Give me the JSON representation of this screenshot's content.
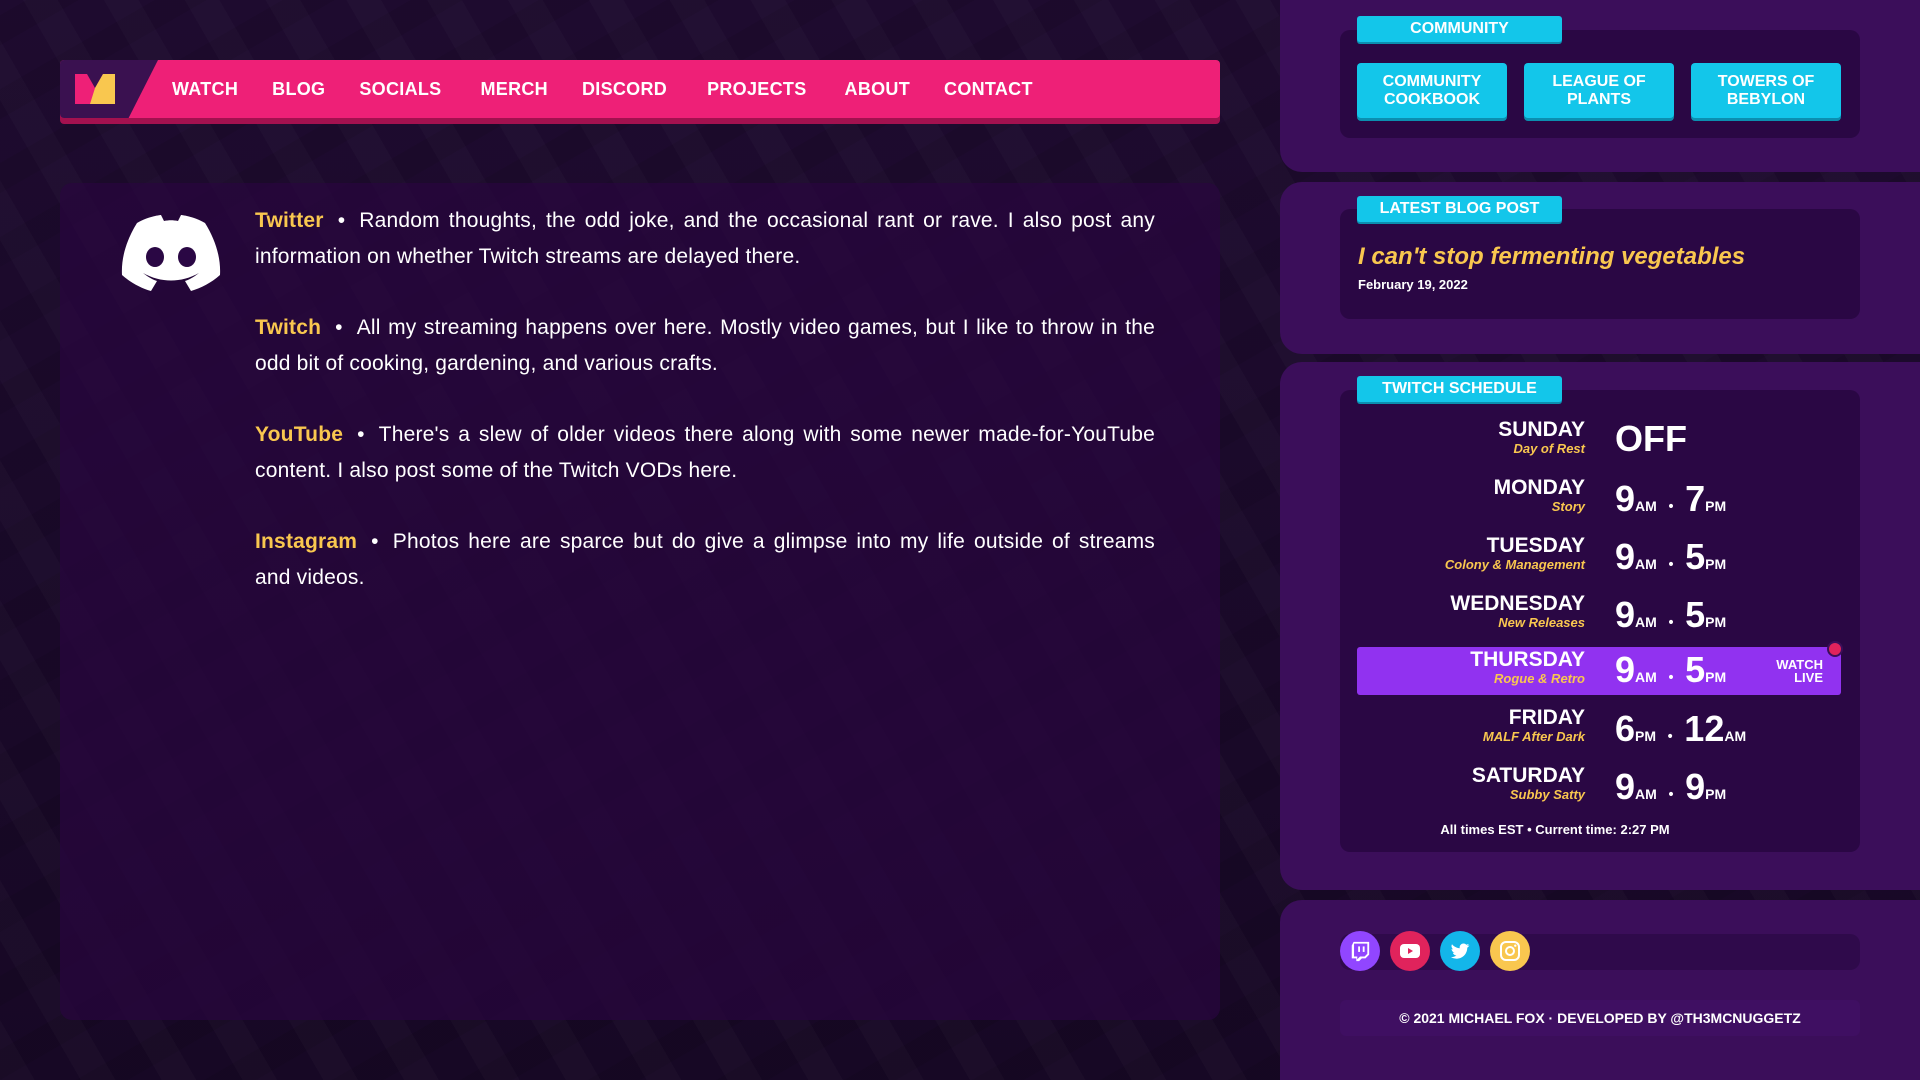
{
  "nav": {
    "items": [
      "WATCH",
      "BLOG",
      "SOCIALS",
      "MERCH",
      "DISCORD",
      "PROJECTS",
      "ABOUT",
      "CONTACT"
    ]
  },
  "socials": [
    {
      "name": "Twitter",
      "text": "Random thoughts, the odd joke, and the occasional rant or rave. I also post any information on whether Twitch streams are delayed there."
    },
    {
      "name": "Twitch",
      "text": "All my streaming happens over here. Mostly video games, but I like to throw in the odd bit of cooking, gardening, and various crafts."
    },
    {
      "name": "YouTube",
      "text": "There's a slew of older videos there along with some newer made-for-YouTube content. I also post some of the Twitch VODs here."
    },
    {
      "name": "Instagram",
      "text": "Photos here are sparce but do give a glimpse into my life outside of streams and videos."
    }
  ],
  "separator": "•",
  "community": {
    "tag": "COMMUNITY",
    "buttons": [
      {
        "line1": "COMMUNITY",
        "line2": "COOKBOOK"
      },
      {
        "line1": "LEAGUE OF",
        "line2": "PLANTS"
      },
      {
        "line1": "TOWERS OF",
        "line2": "BEBYLON"
      }
    ]
  },
  "blog": {
    "tag": "LATEST BLOG POST",
    "title": "I can't stop fermenting vegetables",
    "date": "February 19, 2022"
  },
  "schedule": {
    "tag": "TWITCH SCHEDULE",
    "days": [
      {
        "day": "SUNDAY",
        "theme": "Day of Rest",
        "off": "OFF"
      },
      {
        "day": "MONDAY",
        "theme": "Story",
        "start": "9",
        "start_suf": "AM",
        "end": "7",
        "end_suf": "PM"
      },
      {
        "day": "TUESDAY",
        "theme": "Colony & Management",
        "start": "9",
        "start_suf": "AM",
        "end": "5",
        "end_suf": "PM"
      },
      {
        "day": "WEDNESDAY",
        "theme": "New Releases",
        "start": "9",
        "start_suf": "AM",
        "end": "5",
        "end_suf": "PM"
      },
      {
        "day": "THURSDAY",
        "theme": "Rogue & Retro",
        "start": "9",
        "start_suf": "AM",
        "end": "5",
        "end_suf": "PM",
        "watch_line1": "WATCH",
        "watch_line2": "LIVE"
      },
      {
        "day": "FRIDAY",
        "theme": "MALF After Dark",
        "start": "6",
        "start_suf": "PM",
        "end": "12",
        "end_suf": "AM"
      },
      {
        "day": "SATURDAY",
        "theme": "Subby Satty",
        "start": "9",
        "start_suf": "AM",
        "end": "9",
        "end_suf": "PM"
      }
    ],
    "footer": "All times EST  •  Current time: 2:27 PM"
  },
  "footer": {
    "copyright": "© 2021 MICHAEL FOX  ·  DEVELOPED BY @TH3MCNUGGETZ"
  },
  "colors": {
    "nav_pink": "#ee2077",
    "accent_cyan": "#13c6ea",
    "accent_yellow": "#f9c74f",
    "live_purple": "#9132f0",
    "twitch_purple": "#9146ff",
    "youtube_red": "#e0235c",
    "twitter_blue": "#13b6ea"
  },
  "icons": [
    "logo-icon",
    "discord-icon",
    "twitch-icon",
    "youtube-icon",
    "twitter-icon",
    "instagram-icon"
  ]
}
